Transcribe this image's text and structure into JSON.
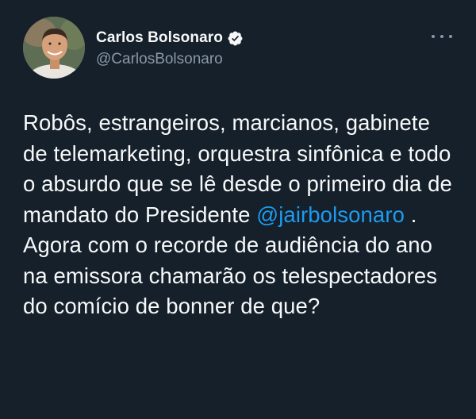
{
  "author": {
    "name": "Carlos Bolsonaro",
    "handle": "@CarlosBolsonaro",
    "verified": true,
    "avatar_icon": "profile-photo"
  },
  "menu": {
    "icon": "more-options-icon"
  },
  "tweet": {
    "text_before": "Robôs, estrangeiros, marcianos, gabinete de telemarketing, orquestra sinfônica e todo o absurdo que se lê desde o primeiro dia de mandato do Presidente ",
    "mention": "@jairbolsonaro",
    "text_after": " . Agora com o recorde de audiência do ano na emissora chamarão os telespectadores do comício de bonner de que?"
  },
  "colors": {
    "background": "#15202b",
    "text": "#f7f9f9",
    "secondary_text": "#8b98a5",
    "accent": "#1d9bf0"
  }
}
